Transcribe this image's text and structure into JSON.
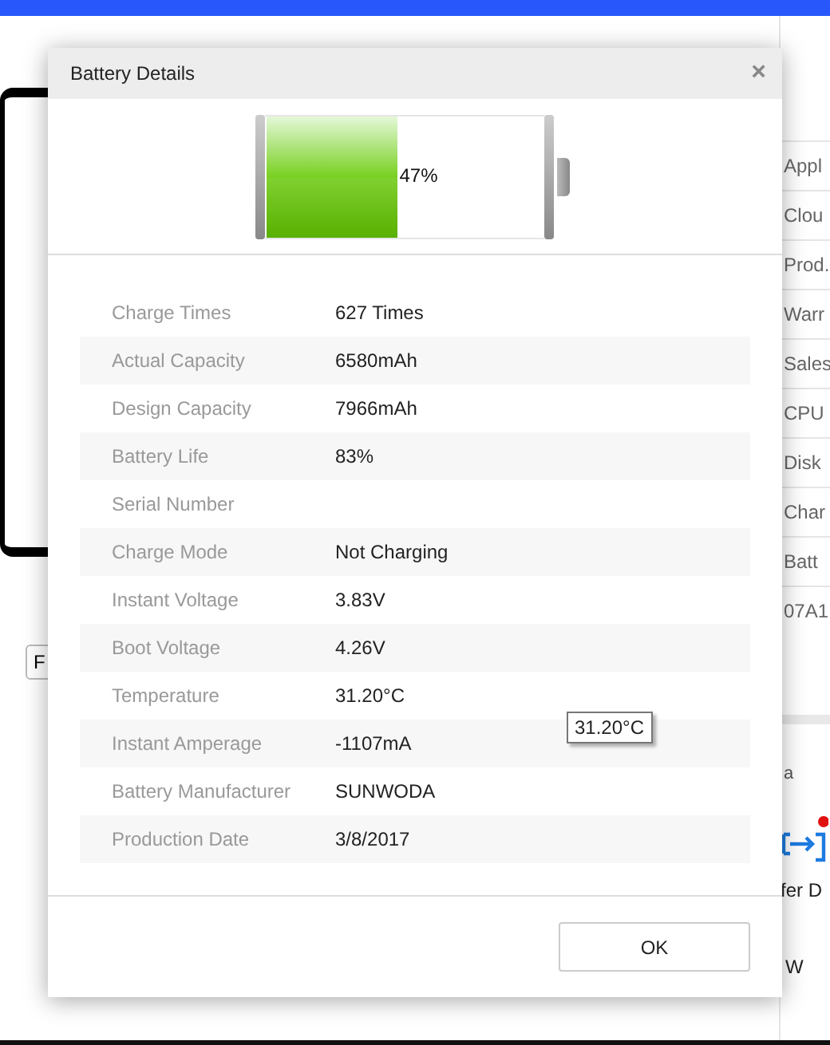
{
  "background": {
    "side_items": [
      "Appl",
      "Clou",
      "Prod.",
      "Warr",
      "Sales",
      "CPU",
      "Disk",
      "Char",
      "Batt",
      "07A1"
    ],
    "left_button": "F",
    "section_label": "a",
    "transfer_label": "fer D",
    "bottom_label": "W"
  },
  "dialog": {
    "title": "Battery Details",
    "close": "×",
    "battery": {
      "level": 0.47,
      "label": "47%"
    },
    "rows": [
      {
        "label": "Charge Times",
        "value": "627 Times"
      },
      {
        "label": "Actual Capacity",
        "value": "6580mAh"
      },
      {
        "label": "Design Capacity",
        "value": "7966mAh"
      },
      {
        "label": "Battery Life",
        "value": "83%"
      },
      {
        "label": "Serial Number"
      },
      {
        "label": "Charge Mode",
        "value": "Not Charging"
      },
      {
        "label": "Instant Voltage",
        "value": "3.83V"
      },
      {
        "label": "Boot Voltage",
        "value": "4.26V"
      },
      {
        "label": "Temperature",
        "value": "31.20°C"
      },
      {
        "label": "Instant Amperage",
        "value": "-1107mA"
      },
      {
        "label": "Battery Manufacturer",
        "value": "SUNWODA"
      },
      {
        "label": "Production Date",
        "value": "3/8/2017"
      }
    ],
    "tooltip": "31.20°C",
    "ok": "OK"
  }
}
